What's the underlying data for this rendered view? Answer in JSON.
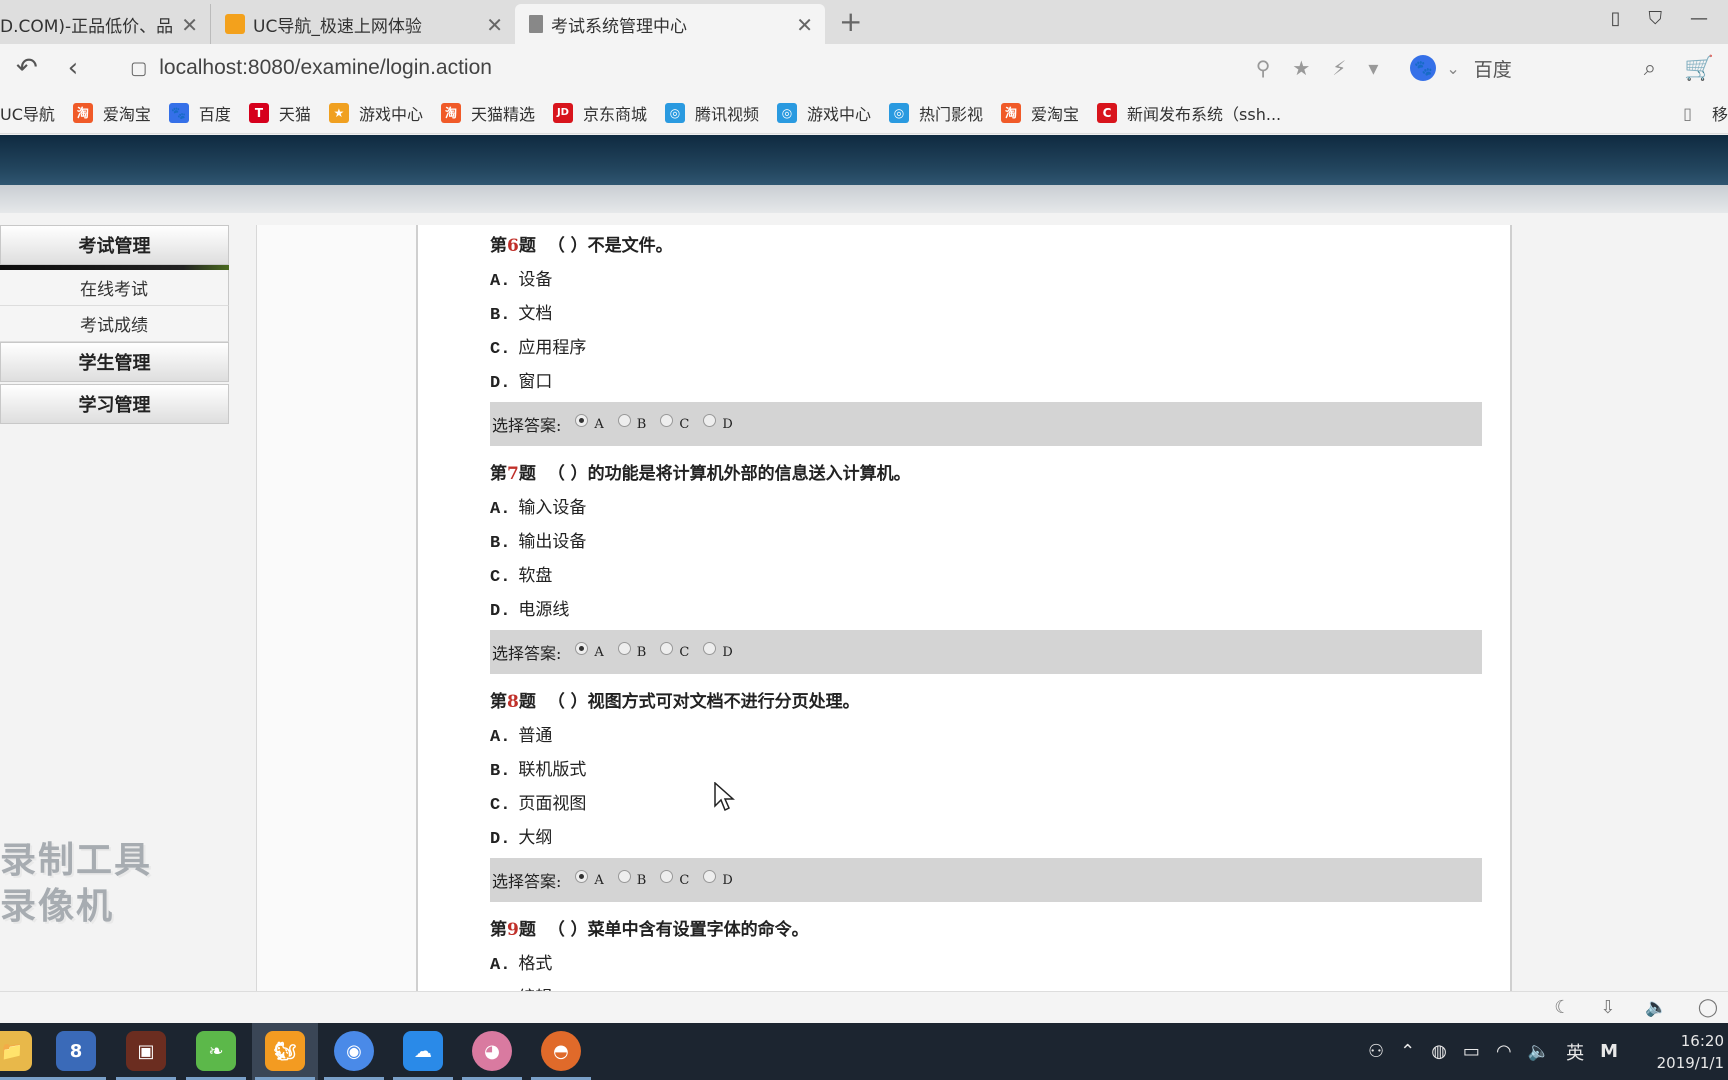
{
  "browser": {
    "tabs": [
      {
        "title": "D.COM)-正品低价、品",
        "active": false,
        "favicon_color": "#ffffff"
      },
      {
        "title": "UC导航_极速上网体验",
        "active": false,
        "favicon_color": "#f3a11c"
      },
      {
        "title": "考试系统管理中心",
        "active": true,
        "favicon_color": "#888888"
      }
    ],
    "tab_close_glyph": "✕",
    "new_tab_glyph": "+",
    "url": "localhost:8080/examine/login.action",
    "search_engine": "百度",
    "search_engine_logo": "🐾",
    "bookmarks": [
      {
        "label": "UC导航",
        "icon": "",
        "color": ""
      },
      {
        "label": "爱淘宝",
        "icon": "淘",
        "color": "#f05a28"
      },
      {
        "label": "百度",
        "icon": "🐾",
        "color": "#3570e8"
      },
      {
        "label": "天猫",
        "icon": "T",
        "color": "#d6001c"
      },
      {
        "label": "游戏中心",
        "icon": "★",
        "color": "#f0a020"
      },
      {
        "label": "天猫精选",
        "icon": "淘",
        "color": "#f05a28"
      },
      {
        "label": "京东商城",
        "icon": "JD",
        "color": "#d8141c"
      },
      {
        "label": "腾讯视频",
        "icon": "◎",
        "color": "#2a9ae0"
      },
      {
        "label": "游戏中心",
        "icon": "◎",
        "color": "#2a9ae0"
      },
      {
        "label": "热门影视",
        "icon": "◎",
        "color": "#2a9ae0"
      },
      {
        "label": "爱淘宝",
        "icon": "淘",
        "color": "#f05a28"
      },
      {
        "label": "新闻发布系统（ssh...",
        "icon": "C",
        "color": "#d8141c"
      }
    ],
    "bookmark_overflow": "移"
  },
  "sidebar": {
    "groups": [
      {
        "title": "考试管理",
        "items": [
          "在线考试",
          "考试成绩"
        ]
      },
      {
        "title": "学生管理",
        "items": []
      },
      {
        "title": "学习管理",
        "items": []
      }
    ]
  },
  "exam": {
    "answer_label": "选择答案:",
    "choice_letters": [
      "A",
      "B",
      "C",
      "D"
    ],
    "questions": [
      {
        "prefix": "第",
        "num": "6",
        "suffix": "题",
        "text": "（ ）不是文件。",
        "options": [
          {
            "letter": "A.",
            "text": "设备"
          },
          {
            "letter": "B.",
            "text": "文档"
          },
          {
            "letter": "C.",
            "text": "应用程序"
          },
          {
            "letter": "D.",
            "text": "窗口"
          }
        ],
        "selected": "A"
      },
      {
        "prefix": "第",
        "num": "7",
        "suffix": "题",
        "text": "（ ）的功能是将计算机外部的信息送入计算机。",
        "options": [
          {
            "letter": "A.",
            "text": "输入设备"
          },
          {
            "letter": "B.",
            "text": "输出设备"
          },
          {
            "letter": "C.",
            "text": "软盘"
          },
          {
            "letter": "D.",
            "text": "电源线"
          }
        ],
        "selected": "A"
      },
      {
        "prefix": "第",
        "num": "8",
        "suffix": "题",
        "text": "（ ）视图方式可对文档不进行分页处理。",
        "options": [
          {
            "letter": "A.",
            "text": "普通"
          },
          {
            "letter": "B.",
            "text": "联机版式"
          },
          {
            "letter": "C.",
            "text": "页面视图"
          },
          {
            "letter": "D.",
            "text": "大纲"
          }
        ],
        "selected": "A"
      },
      {
        "prefix": "第",
        "num": "9",
        "suffix": "题",
        "text": "（ ）菜单中含有设置字体的命令。",
        "options": [
          {
            "letter": "A.",
            "text": "格式"
          },
          {
            "letter": "B.",
            "text": "编辑"
          }
        ],
        "selected": ""
      }
    ]
  },
  "watermark": {
    "line1": "录制工具",
    "line2": "录像机"
  },
  "taskbar": {
    "apps": [
      {
        "name": "file-explorer",
        "glyph": "📁",
        "color": "#e8b84a"
      },
      {
        "name": "app-8",
        "glyph": "8",
        "color": "#3a6ab8"
      },
      {
        "name": "video-editor",
        "glyph": "▣",
        "color": "#6b2d20"
      },
      {
        "name": "green-app",
        "glyph": "❧",
        "color": "#5cb84a"
      },
      {
        "name": "uc-browser",
        "glyph": "🐿",
        "color": "#f39b21"
      },
      {
        "name": "chrome",
        "glyph": "◉",
        "color": "#4a8ae8"
      },
      {
        "name": "baidu-netdisk",
        "glyph": "☁",
        "color": "#2a8ae8"
      },
      {
        "name": "pink-app",
        "glyph": "◕",
        "color": "#d97aa0"
      },
      {
        "name": "orange-app",
        "glyph": "◓",
        "color": "#e06a2a"
      }
    ],
    "ime": "英",
    "time": "16:20",
    "date": "2019/1/1"
  }
}
